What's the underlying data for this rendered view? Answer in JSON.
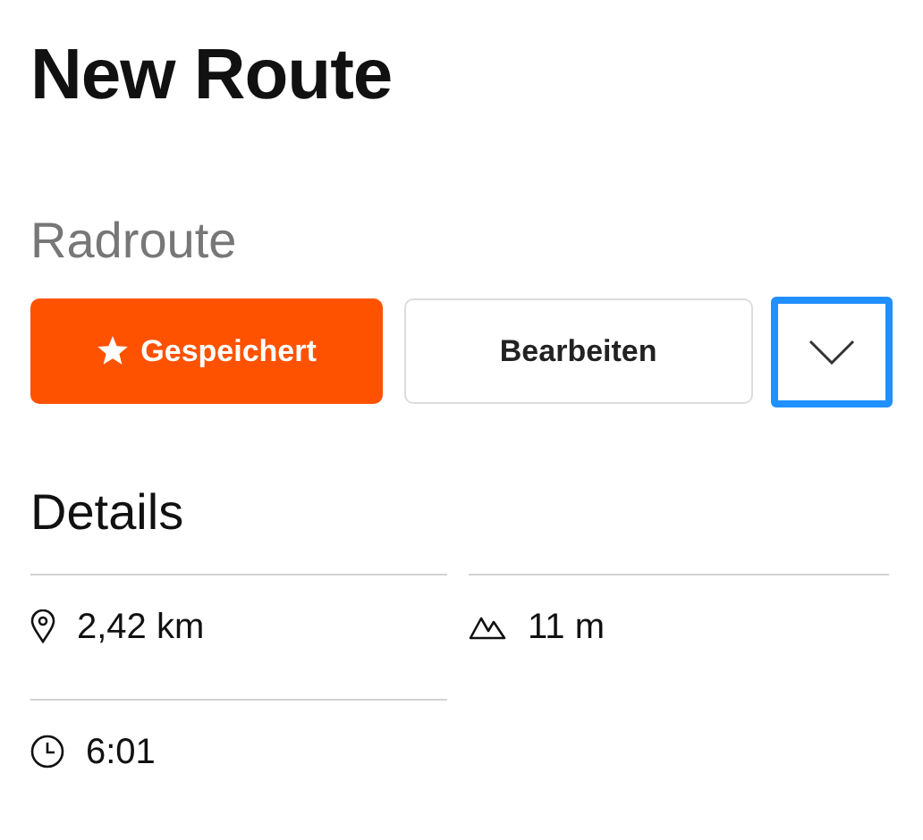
{
  "title": "New Route",
  "subtitle": "Radroute",
  "buttons": [
    {
      "kind": "saved",
      "label": "Gespeichert"
    },
    {
      "kind": "edit",
      "label": "Bearbeiten"
    },
    {
      "kind": "more",
      "focused": true
    }
  ],
  "details": {
    "heading": "Details",
    "stats": [
      {
        "kind": "distance",
        "value": "2,42 km"
      },
      {
        "kind": "elevation",
        "value": "11 m"
      },
      {
        "kind": "duration",
        "value": "6:01"
      }
    ]
  }
}
